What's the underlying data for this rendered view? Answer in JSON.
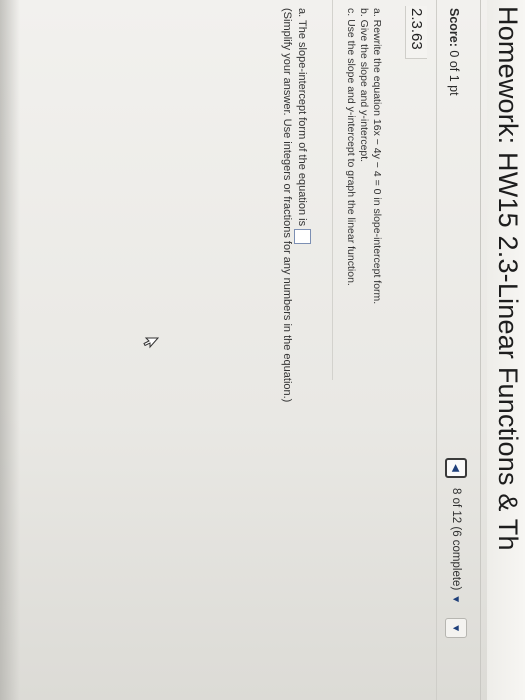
{
  "header": {
    "title": "Homework: HW15 2.3-Linear Functions & Th"
  },
  "score": {
    "label": "Score:",
    "value": "0 of 1 pt"
  },
  "navigation": {
    "progress": "8 of 12 (6 complete)",
    "prev_icon": "left-triangle",
    "next_icon": "down-triangle",
    "caret_icon": "down-triangle"
  },
  "problem": {
    "id": "2.3.63",
    "instructions": [
      "a. Rewrite the equation 16x − 4y − 4 = 0 in slope-intercept form.",
      "b. Give the slope and y-intercept.",
      "c. Use the slope and y-intercept to graph the linear function."
    ],
    "question_a": "a. The slope-intercept form of the equation is",
    "hint": "(Simplify your answer. Use integers or fractions for any numbers in the equation.)"
  },
  "colors": {
    "accent": "#1e3f7a",
    "text": "#2b2b2b",
    "background": "#efeeea"
  }
}
